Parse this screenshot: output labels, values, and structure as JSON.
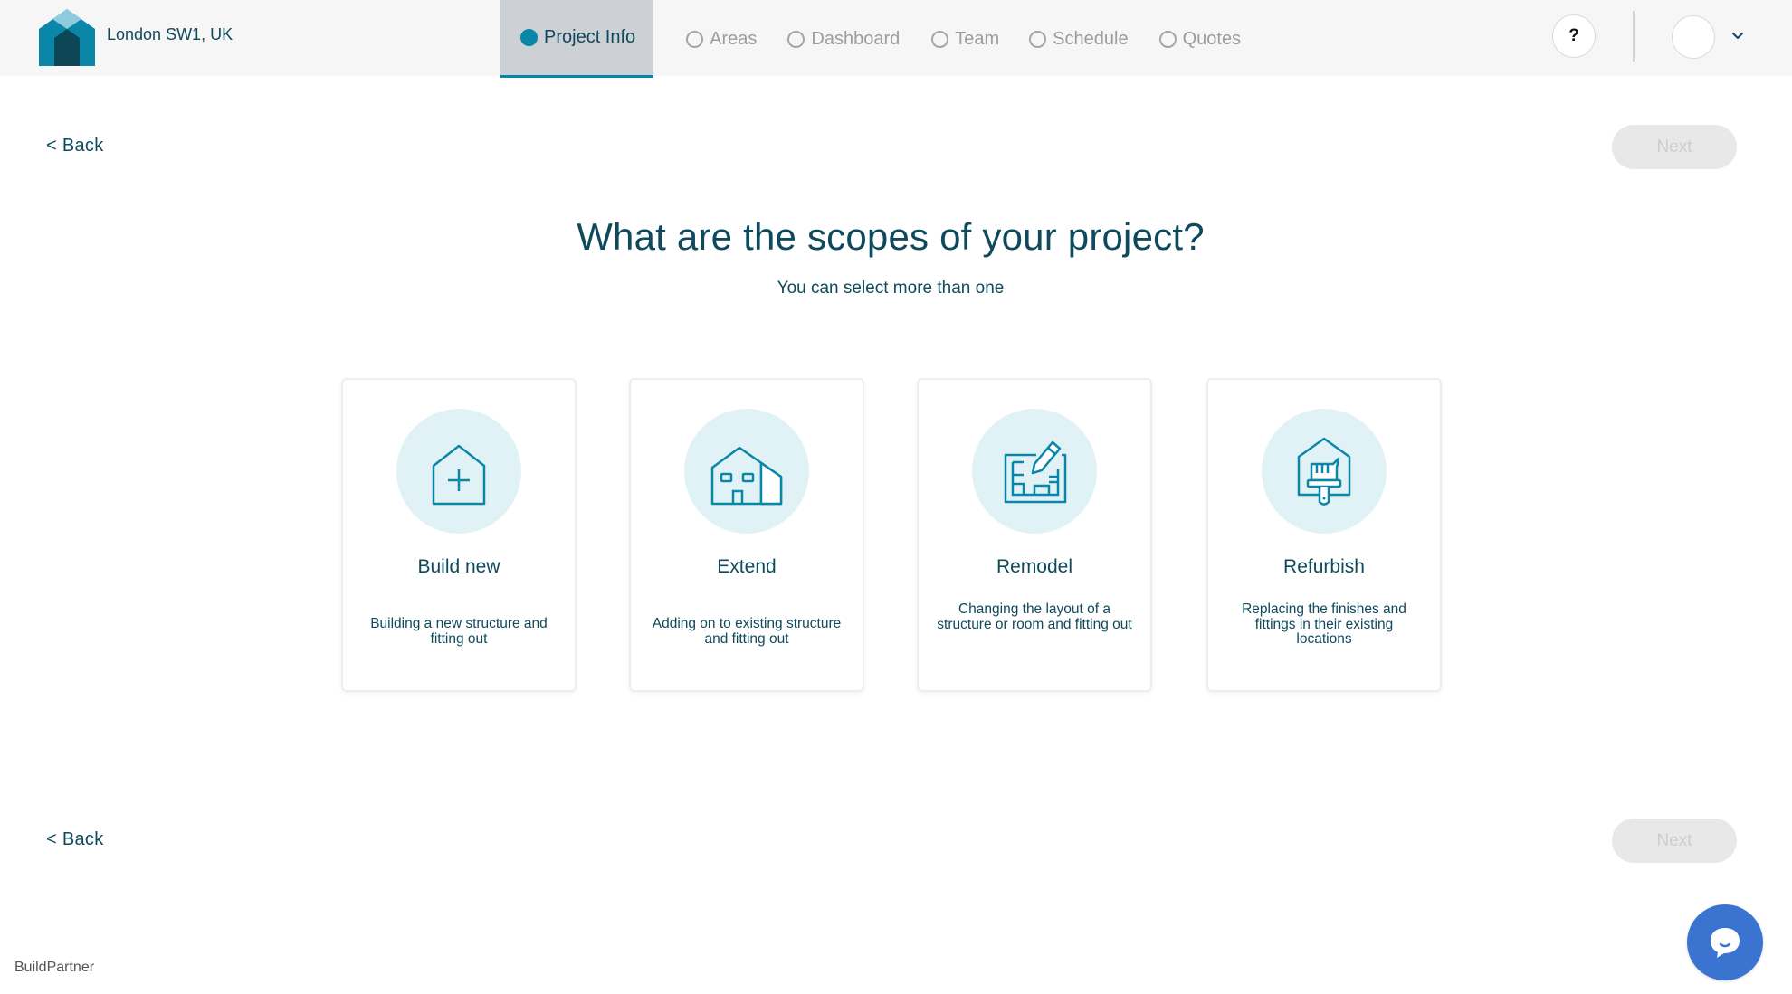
{
  "header": {
    "location": "London SW1, UK",
    "logo_icon": "house-logo-icon",
    "tabs": [
      {
        "label": "Project Info",
        "active": true
      },
      {
        "label": "Areas",
        "active": false
      },
      {
        "label": "Dashboard",
        "active": false
      },
      {
        "label": "Team",
        "active": false
      },
      {
        "label": "Schedule",
        "active": false
      },
      {
        "label": "Quotes",
        "active": false
      }
    ],
    "help_label": "?",
    "avatar_icon": "avatar-icon",
    "menu_icon": "chevron-down-icon"
  },
  "nav": {
    "back_label": "< Back",
    "next_label": "Next",
    "next_enabled": false
  },
  "main": {
    "title": "What are the scopes of your project?",
    "subtitle": "You can select more than one",
    "options": [
      {
        "title": "Build new",
        "description": "Building a new structure and fitting out",
        "icon": "house-plus-icon"
      },
      {
        "title": "Extend",
        "description": "Adding on to existing structure and fitting out",
        "icon": "house-extension-icon"
      },
      {
        "title": "Remodel",
        "description": "Changing the layout of a structure or room and fitting out",
        "icon": "floorplan-pencil-icon"
      },
      {
        "title": "Refurbish",
        "description": "Replacing the finishes and fittings in their existing locations",
        "icon": "house-paintbrush-icon"
      }
    ]
  },
  "footer": {
    "brand": "BuildPartner",
    "chat_icon": "chat-bubble-icon"
  },
  "colors": {
    "primary_dark": "#0e4a5c",
    "accent": "#0a87a8",
    "icon_bg": "#e1f2f7",
    "chat": "#3b73d1",
    "disabled_bg": "#e8e8e8"
  }
}
